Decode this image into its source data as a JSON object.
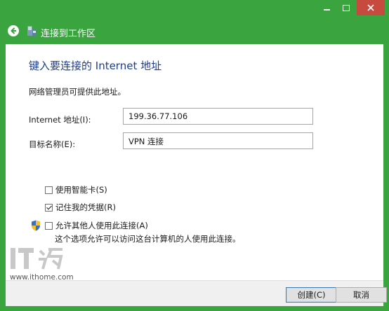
{
  "window": {
    "nav_title": "连接到工作区"
  },
  "page": {
    "heading": "键入要连接的 Internet 地址",
    "hint": "网络管理员可提供此地址。",
    "address_label": "Internet 地址(I):",
    "address_value": "199.36.77.106",
    "name_label": "目标名称(E):",
    "name_value": "VPN 连接",
    "smartcard_label": "使用智能卡(S)",
    "smartcard_checked": false,
    "remember_label": "记住我的凭据(R)",
    "remember_checked": true,
    "allow_others_label": "允许其他人使用此连接(A)",
    "allow_others_checked": false,
    "allow_others_desc": "这个选项允许可以访问这台计算机的人使用此连接。"
  },
  "watermark": {
    "logo_text": "IT之家",
    "url": "www.ithome.com"
  },
  "footer": {
    "create_label": "创建(C)",
    "cancel_label": "取消"
  },
  "colors": {
    "chrome": "#3aa53f",
    "heading": "#1e3d8c",
    "close": "#c74a3f"
  }
}
